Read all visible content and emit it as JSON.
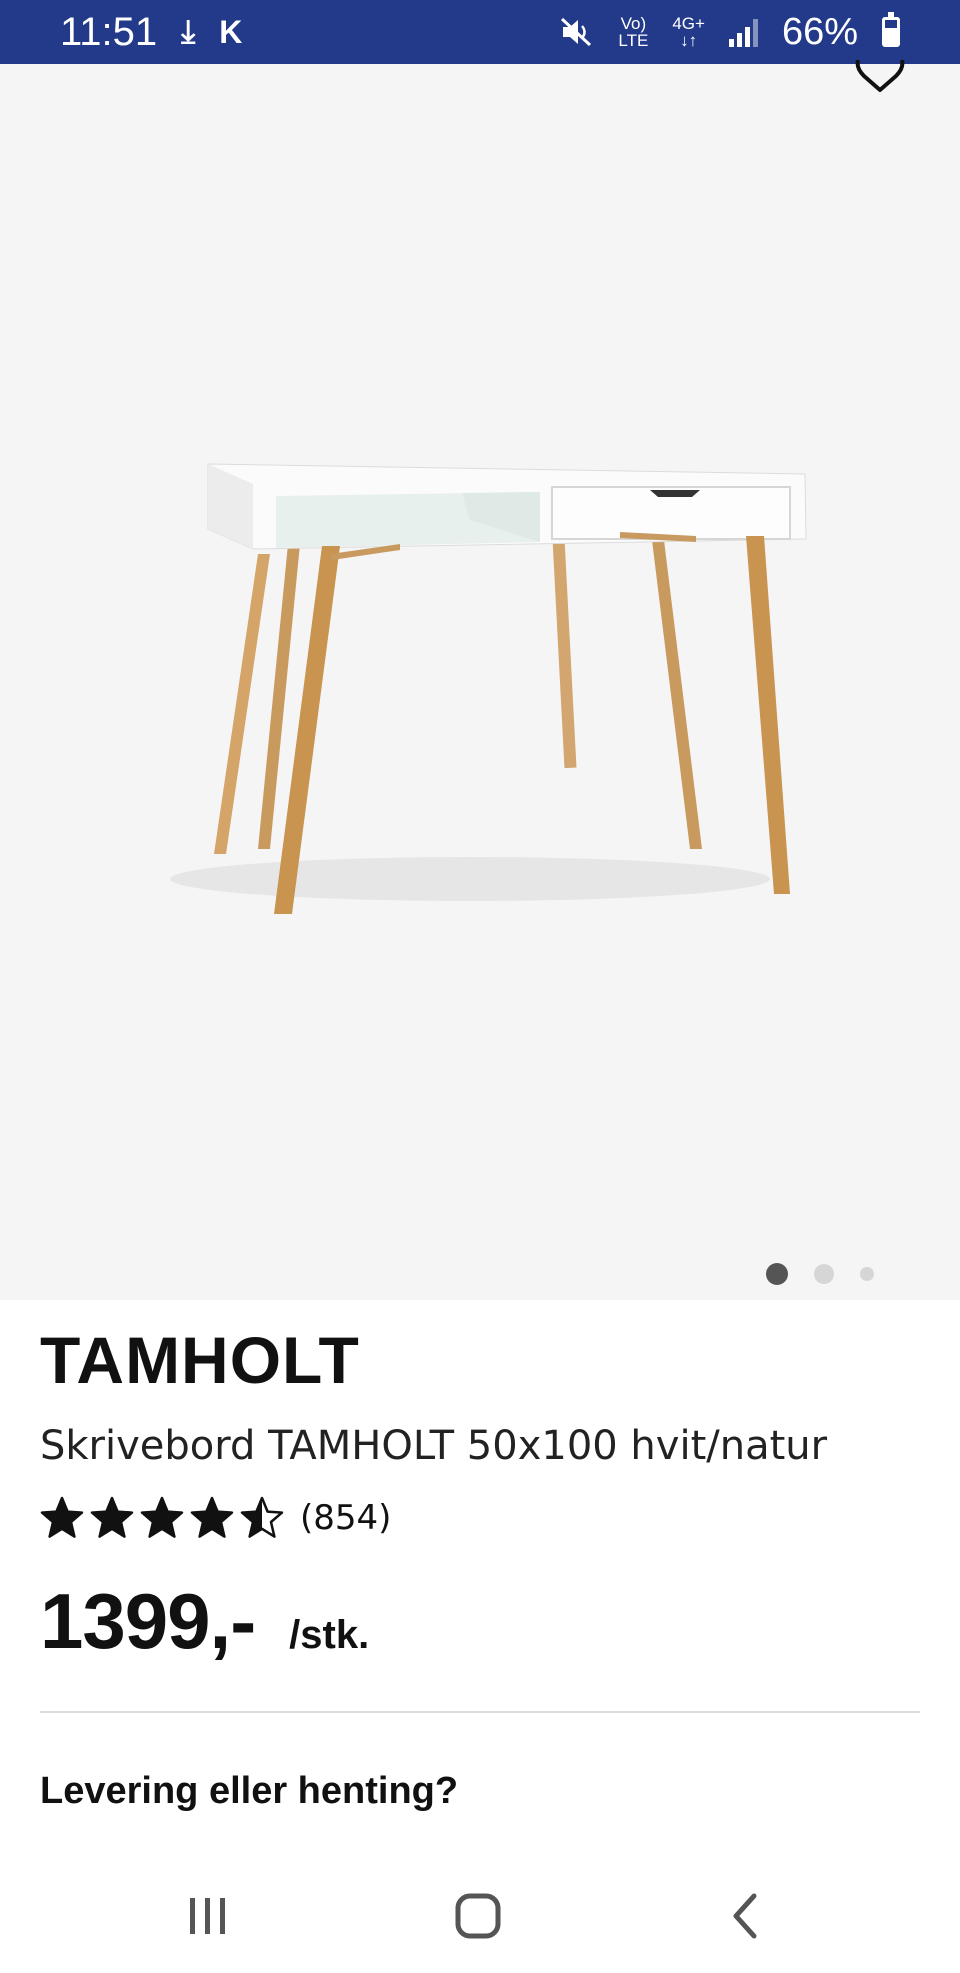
{
  "status_bar": {
    "time": "11:51",
    "download_glyph": "⤓",
    "app_glyph": "K",
    "volte_top": "Vo)",
    "volte_bottom": "LTE",
    "network_top": "4G+",
    "network_bottom": "↓↑",
    "battery_percent": "66%",
    "battery_level": 0.66,
    "bg_color": "#233a8a"
  },
  "gallery": {
    "favorite_icon": "heart-outline-icon",
    "image_subject": "white desk with natural wood legs",
    "slide_count": 3,
    "active_slide": 1
  },
  "product": {
    "brand": "TAMHOLT",
    "description": "Skrivebord TAMHOLT 50x100 hvit/natur",
    "rating": 4.5,
    "rating_max": 5,
    "review_count": "(854)",
    "price": "1399,-",
    "unit": "/stk."
  },
  "delivery": {
    "title": "Levering eller henting?"
  },
  "nav_bar": {
    "recents_icon": "recent-apps-icon",
    "home_icon": "home-icon",
    "back_icon": "back-icon"
  }
}
